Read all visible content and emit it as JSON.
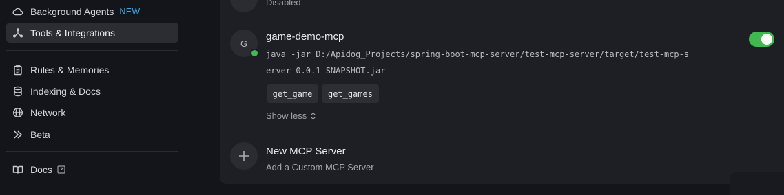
{
  "sidebar": {
    "items": [
      {
        "label": "Background Agents",
        "icon": "cloud-icon",
        "badge": "NEW"
      },
      {
        "label": "Tools & Integrations",
        "icon": "tools-icon",
        "active": true
      },
      {
        "label": "Rules & Memories",
        "icon": "clipboard-icon"
      },
      {
        "label": "Indexing & Docs",
        "icon": "database-icon"
      },
      {
        "label": "Network",
        "icon": "globe-icon"
      },
      {
        "label": "Beta",
        "icon": "chevrons-right-icon"
      },
      {
        "label": "Docs",
        "icon": "book-icon",
        "external": true
      }
    ]
  },
  "main": {
    "previous_server_status": "Disabled",
    "server": {
      "avatar_letter": "G",
      "name": "game-demo-mcp",
      "command_line1": "java -jar D:/Apidog_Projects/spring-boot-mcp-server/test-mcp-server/target/test-mcp-s",
      "command_line2": "erver-0.0.1-SNAPSHOT.jar",
      "enabled": true,
      "tools": [
        "get_game",
        "get_games"
      ],
      "show_less_label": "Show less"
    },
    "new_server": {
      "title": "New MCP Server",
      "subtitle": "Add a Custom MCP Server"
    }
  },
  "colors": {
    "accent_green": "#3fb950",
    "badge_blue": "#3aa6e0",
    "background": "#14151a",
    "panel": "#1d1f24"
  }
}
